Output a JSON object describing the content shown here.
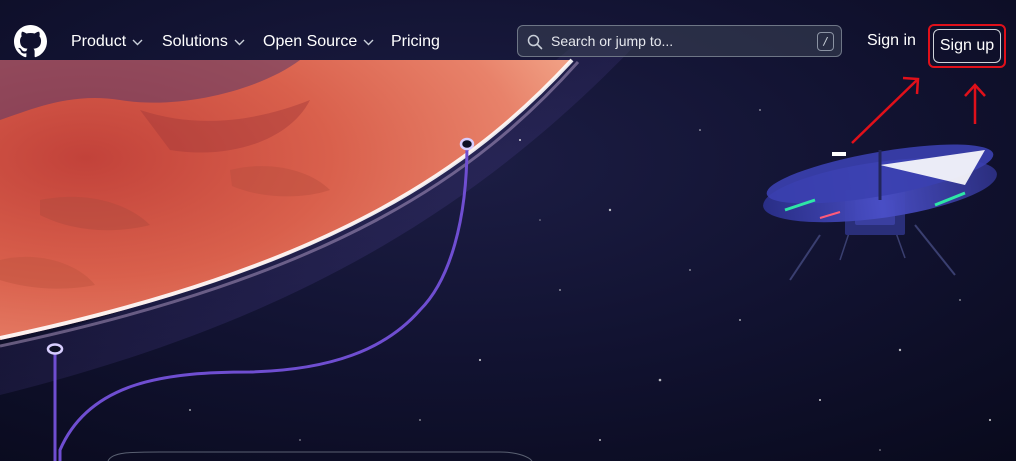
{
  "nav": {
    "items": [
      {
        "label": "Product",
        "has_dropdown": true
      },
      {
        "label": "Solutions",
        "has_dropdown": true
      },
      {
        "label": "Open Source",
        "has_dropdown": true
      },
      {
        "label": "Pricing",
        "has_dropdown": false
      }
    ],
    "logo_icon": "github-octocat-icon"
  },
  "search": {
    "placeholder": "Search or jump to...",
    "shortcut_key": "/",
    "icon": "search-icon"
  },
  "auth": {
    "sign_in": "Sign in",
    "sign_up": "Sign up"
  },
  "annotation": {
    "highlight_color": "#e0101a",
    "target": "Sign up"
  },
  "colors": {
    "background": "#0d0f24",
    "planet": "#d9604c",
    "path_line": "#6f4ed1"
  }
}
